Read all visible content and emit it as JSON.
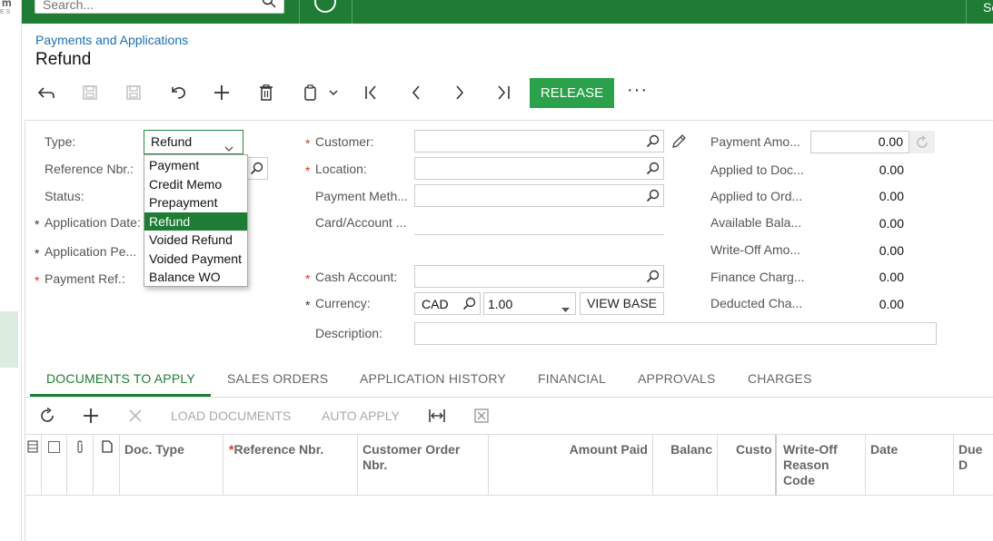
{
  "topbar": {
    "search_placeholder": "Search...",
    "right_text": "Sc"
  },
  "logo": {
    "text": "m",
    "sub": "ES"
  },
  "breadcrumb": "Payments and Applications",
  "page_title": "Refund",
  "toolbar": {
    "release_label": "RELEASE",
    "more_label": "···"
  },
  "form": {
    "type_label": "Type:",
    "type_value": "Refund",
    "type_options": [
      "Payment",
      "Credit Memo",
      "Prepayment",
      "Refund",
      "Voided Refund",
      "Voided Payment",
      "Balance WO"
    ],
    "refnbr_label": "Reference Nbr.:",
    "status_label": "Status:",
    "appdate_label": "Application Date:",
    "appperiod_label": "Application Pe...",
    "payref_label": "Payment Ref.:",
    "customer_label": "Customer:",
    "location_label": "Location:",
    "paymethod_label": "Payment Meth...",
    "cardaccount_label": "Card/Account ...",
    "cashaccount_label": "Cash Account:",
    "currency_label": "Currency:",
    "currency_code": "CAD",
    "currency_rate": "1.00",
    "viewbase_label": "VIEW BASE",
    "description_label": "Description:",
    "payment_amount_label": "Payment Amo...",
    "payment_amount": "0.00",
    "applied_docs_label": "Applied to Doc...",
    "applied_docs": "0.00",
    "applied_orders_label": "Applied to Ord...",
    "applied_orders": "0.00",
    "available_label": "Available Bala...",
    "available": "0.00",
    "writeoff_label": "Write-Off Amo...",
    "writeoff": "0.00",
    "finance_label": "Finance Charg...",
    "finance": "0.00",
    "deducted_label": "Deducted Cha...",
    "deducted": "0.00",
    "req_mark": "*"
  },
  "tabs": [
    "DOCUMENTS TO APPLY",
    "SALES ORDERS",
    "APPLICATION HISTORY",
    "FINANCIAL",
    "APPROVALS",
    "CHARGES"
  ],
  "grid_toolbar": {
    "load_documents": "LOAD DOCUMENTS",
    "auto_apply": "AUTO APPLY"
  },
  "grid_columns": {
    "doc_type": "Doc. Type",
    "ref_nbr": "Reference Nbr.",
    "cust_order": "Customer Order Nbr.",
    "amount_paid": "Amount Paid",
    "balance": "Balanc",
    "custo": "Custo",
    "writeoff_reason": "Write-Off Reason Code",
    "date": "Date",
    "due_date": "Due D"
  }
}
